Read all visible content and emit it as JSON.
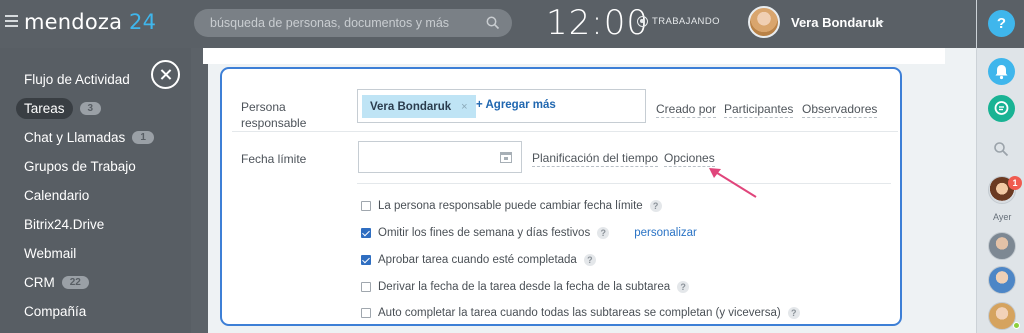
{
  "header": {
    "logo_text": "mendoza",
    "logo_number": "24",
    "search_placeholder": "búsqueda de personas, documentos y más",
    "clock": "12:00",
    "status": "TRABAJANDO",
    "user_name": "Vera Bondaruk"
  },
  "sidebar": {
    "items": [
      {
        "label": "Flujo de Actividad"
      },
      {
        "label": "Tareas",
        "count": "3",
        "active": true
      },
      {
        "label": "Chat y Llamadas",
        "count": "1"
      },
      {
        "label": "Grupos de Trabajo"
      },
      {
        "label": "Calendario"
      },
      {
        "label": "Bitrix24.Drive"
      },
      {
        "label": "Webmail"
      },
      {
        "label": "CRM",
        "count": "22"
      },
      {
        "label": "Compañía"
      }
    ]
  },
  "form": {
    "responsible_label": "Persona responsable",
    "responsible_tag": "Vera Bondaruk",
    "tag_remove": "×",
    "add_more": "+ Agregar más",
    "role_links": [
      "Creado por",
      "Participantes",
      "Observadores"
    ],
    "deadline_label": "Fecha límite",
    "deadline_value": "",
    "deadline_links": [
      "Planificación del tiempo",
      "Opciones"
    ],
    "options": [
      {
        "label": "La persona responsable puede cambiar fecha límite",
        "checked": false
      },
      {
        "label": "Omitir los fines de semana y días festivos",
        "checked": true,
        "extra": "personalizar"
      },
      {
        "label": "Aprobar tarea cuando esté completada",
        "checked": true
      },
      {
        "label": "Derivar la fecha de la tarea desde la fecha de la subtarea",
        "checked": false
      },
      {
        "label": "Auto completar la tarea cuando todas las subtareas se completan (y viceversa)",
        "checked": false
      }
    ],
    "help_glyph": "?"
  },
  "rail": {
    "help": "?",
    "notification_count": "1",
    "day_label": "Ayer"
  },
  "colors": {
    "accent": "#3fb6ec",
    "highlight_border": "#3d7fd6",
    "arrow": "#e0457b",
    "checkbox": "#2f6ec1"
  },
  "icons": {
    "search": "search-icon",
    "calendar": "calendar-icon",
    "bell": "bell-icon",
    "chat": "chat-icon",
    "close": "close-icon"
  }
}
